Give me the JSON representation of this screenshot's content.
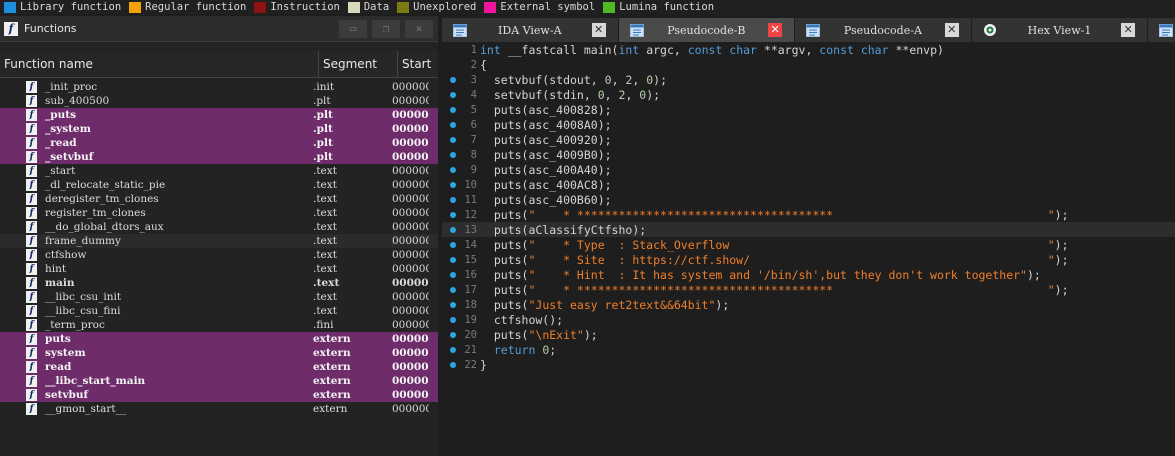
{
  "legend": [
    {
      "label": "Library function",
      "color": "#1f8de0"
    },
    {
      "label": "Regular function",
      "color": "#f5a10a"
    },
    {
      "label": "Instruction",
      "color": "#8e1212"
    },
    {
      "label": "Data",
      "color": "#d9d8b9"
    },
    {
      "label": "Unexplored",
      "color": "#7c7a12"
    },
    {
      "label": "External symbol",
      "color": "#f0149f"
    },
    {
      "label": "Lumina function",
      "color": "#4fbb22"
    }
  ],
  "functions_window": {
    "title": "Functions",
    "columns": {
      "name": "Function name",
      "segment": "Segment",
      "start": "Start"
    },
    "rows": [
      {
        "name": "_init_proc",
        "segment": ".init",
        "start": "000000",
        "style": "normal"
      },
      {
        "name": "sub_400500",
        "segment": ".plt",
        "start": "000000",
        "style": "normal"
      },
      {
        "name": "_puts",
        "segment": ".plt",
        "start": "000000",
        "style": "lib"
      },
      {
        "name": "_system",
        "segment": ".plt",
        "start": "000000",
        "style": "lib"
      },
      {
        "name": "_read",
        "segment": ".plt",
        "start": "000000",
        "style": "lib"
      },
      {
        "name": "_setvbuf",
        "segment": ".plt",
        "start": "000000",
        "style": "lib"
      },
      {
        "name": "_start",
        "segment": ".text",
        "start": "000000",
        "style": "normal"
      },
      {
        "name": "_dl_relocate_static_pie",
        "segment": ".text",
        "start": "000000",
        "style": "normal"
      },
      {
        "name": "deregister_tm_clones",
        "segment": ".text",
        "start": "000000",
        "style": "normal"
      },
      {
        "name": "register_tm_clones",
        "segment": ".text",
        "start": "000000",
        "style": "normal"
      },
      {
        "name": "__do_global_dtors_aux",
        "segment": ".text",
        "start": "000000",
        "style": "normal"
      },
      {
        "name": "frame_dummy",
        "segment": ".text",
        "start": "000000",
        "style": "sel"
      },
      {
        "name": "ctfshow",
        "segment": ".text",
        "start": "000000",
        "style": "normal"
      },
      {
        "name": "hint",
        "segment": ".text",
        "start": "000000",
        "style": "normal"
      },
      {
        "name": "main",
        "segment": ".text",
        "start": "000000",
        "style": "bold"
      },
      {
        "name": "__libc_csu_init",
        "segment": ".text",
        "start": "000000",
        "style": "normal"
      },
      {
        "name": "__libc_csu_fini",
        "segment": ".text",
        "start": "000000",
        "style": "normal"
      },
      {
        "name": "_term_proc",
        "segment": ".fini",
        "start": "000000",
        "style": "normal"
      },
      {
        "name": "puts",
        "segment": "extern",
        "start": "000000",
        "style": "lib"
      },
      {
        "name": "system",
        "segment": "extern",
        "start": "000000",
        "style": "lib"
      },
      {
        "name": "read",
        "segment": "extern",
        "start": "000000",
        "style": "lib"
      },
      {
        "name": "__libc_start_main",
        "segment": "extern",
        "start": "000000",
        "style": "lib"
      },
      {
        "name": "setvbuf",
        "segment": "extern",
        "start": "000000",
        "style": "lib"
      },
      {
        "name": "__gmon_start__",
        "segment": "extern",
        "start": "000000",
        "style": "normal"
      }
    ]
  },
  "tabs": [
    {
      "label": "IDA View-A",
      "icon": "graph-view-icon",
      "active": false
    },
    {
      "label": "Pseudocode-B",
      "icon": "pseudocode-icon",
      "active": true
    },
    {
      "label": "Pseudocode-A",
      "icon": "pseudocode-icon",
      "active": false
    },
    {
      "label": "Hex View-1",
      "icon": "hex-view-icon",
      "active": false
    }
  ],
  "code": [
    {
      "n": "1",
      "dot": false,
      "t": [
        [
          "kw",
          "int "
        ],
        [
          "fn",
          "__fastcall main("
        ],
        [
          "kw",
          "int "
        ],
        [
          "fn",
          "argc, "
        ],
        [
          "kw",
          "const char "
        ],
        [
          "fn",
          "**argv, "
        ],
        [
          "kw",
          "const char "
        ],
        [
          "fn",
          "**envp)"
        ]
      ]
    },
    {
      "n": "2",
      "dot": false,
      "t": [
        [
          "fn",
          "{"
        ]
      ]
    },
    {
      "n": "3",
      "dot": true,
      "t": [
        [
          "fn",
          "  setvbuf(stdout, "
        ],
        [
          "num",
          "0"
        ],
        [
          "fn",
          ", "
        ],
        [
          "num",
          "2"
        ],
        [
          "fn",
          ", "
        ],
        [
          "num",
          "0"
        ],
        [
          "fn",
          ");"
        ]
      ]
    },
    {
      "n": "4",
      "dot": true,
      "t": [
        [
          "fn",
          "  setvbuf(stdin, "
        ],
        [
          "num",
          "0"
        ],
        [
          "fn",
          ", "
        ],
        [
          "num",
          "2"
        ],
        [
          "fn",
          ", "
        ],
        [
          "num",
          "0"
        ],
        [
          "fn",
          ");"
        ]
      ]
    },
    {
      "n": "5",
      "dot": true,
      "t": [
        [
          "fn",
          "  puts(asc_400828);"
        ]
      ]
    },
    {
      "n": "6",
      "dot": true,
      "t": [
        [
          "fn",
          "  puts(asc_4008A0);"
        ]
      ]
    },
    {
      "n": "7",
      "dot": true,
      "t": [
        [
          "fn",
          "  puts(asc_400920);"
        ]
      ]
    },
    {
      "n": "8",
      "dot": true,
      "t": [
        [
          "fn",
          "  puts(asc_4009B0);"
        ]
      ]
    },
    {
      "n": "9",
      "dot": true,
      "t": [
        [
          "fn",
          "  puts(asc_400A40);"
        ]
      ]
    },
    {
      "n": "10",
      "dot": true,
      "t": [
        [
          "fn",
          "  puts(asc_400AC8);"
        ]
      ]
    },
    {
      "n": "11",
      "dot": true,
      "t": [
        [
          "fn",
          "  puts(asc_400B60);"
        ]
      ]
    },
    {
      "n": "12",
      "dot": true,
      "t": [
        [
          "fn",
          "  puts("
        ],
        [
          "str",
          "\"    * *************************************                               \""
        ],
        [
          "fn",
          ");"
        ]
      ]
    },
    {
      "n": "13",
      "dot": true,
      "hl": true,
      "t": [
        [
          "fn",
          "  puts(aClassifyCtfsho);"
        ]
      ]
    },
    {
      "n": "14",
      "dot": true,
      "t": [
        [
          "fn",
          "  puts("
        ],
        [
          "str",
          "\"    * Type  : Stack_Overflow                                              \""
        ],
        [
          "fn",
          ");"
        ]
      ]
    },
    {
      "n": "15",
      "dot": true,
      "t": [
        [
          "fn",
          "  puts("
        ],
        [
          "str",
          "\"    * Site  : https://ctf.show/                                           \""
        ],
        [
          "fn",
          ");"
        ]
      ]
    },
    {
      "n": "16",
      "dot": true,
      "t": [
        [
          "fn",
          "  puts("
        ],
        [
          "str",
          "\"    * Hint  : It has system and '/bin/sh',but they don't work together\""
        ],
        [
          "fn",
          ");"
        ]
      ]
    },
    {
      "n": "17",
      "dot": true,
      "t": [
        [
          "fn",
          "  puts("
        ],
        [
          "str",
          "\"    * *************************************                               \""
        ],
        [
          "fn",
          ");"
        ]
      ]
    },
    {
      "n": "18",
      "dot": true,
      "t": [
        [
          "fn",
          "  puts("
        ],
        [
          "str",
          "\"Just easy ret2text&&64bit\""
        ],
        [
          "fn",
          ");"
        ]
      ]
    },
    {
      "n": "19",
      "dot": true,
      "t": [
        [
          "fn",
          "  ctfshow();"
        ]
      ]
    },
    {
      "n": "20",
      "dot": true,
      "t": [
        [
          "fn",
          "  puts("
        ],
        [
          "str",
          "\"\\nExit\""
        ],
        [
          "fn",
          ");"
        ]
      ]
    },
    {
      "n": "21",
      "dot": true,
      "t": [
        [
          "fn",
          "  "
        ],
        [
          "kw",
          "return "
        ],
        [
          "num",
          "0"
        ],
        [
          "fn",
          ";"
        ]
      ]
    },
    {
      "n": "22",
      "dot": true,
      "t": [
        [
          "fn",
          "}"
        ]
      ]
    }
  ]
}
